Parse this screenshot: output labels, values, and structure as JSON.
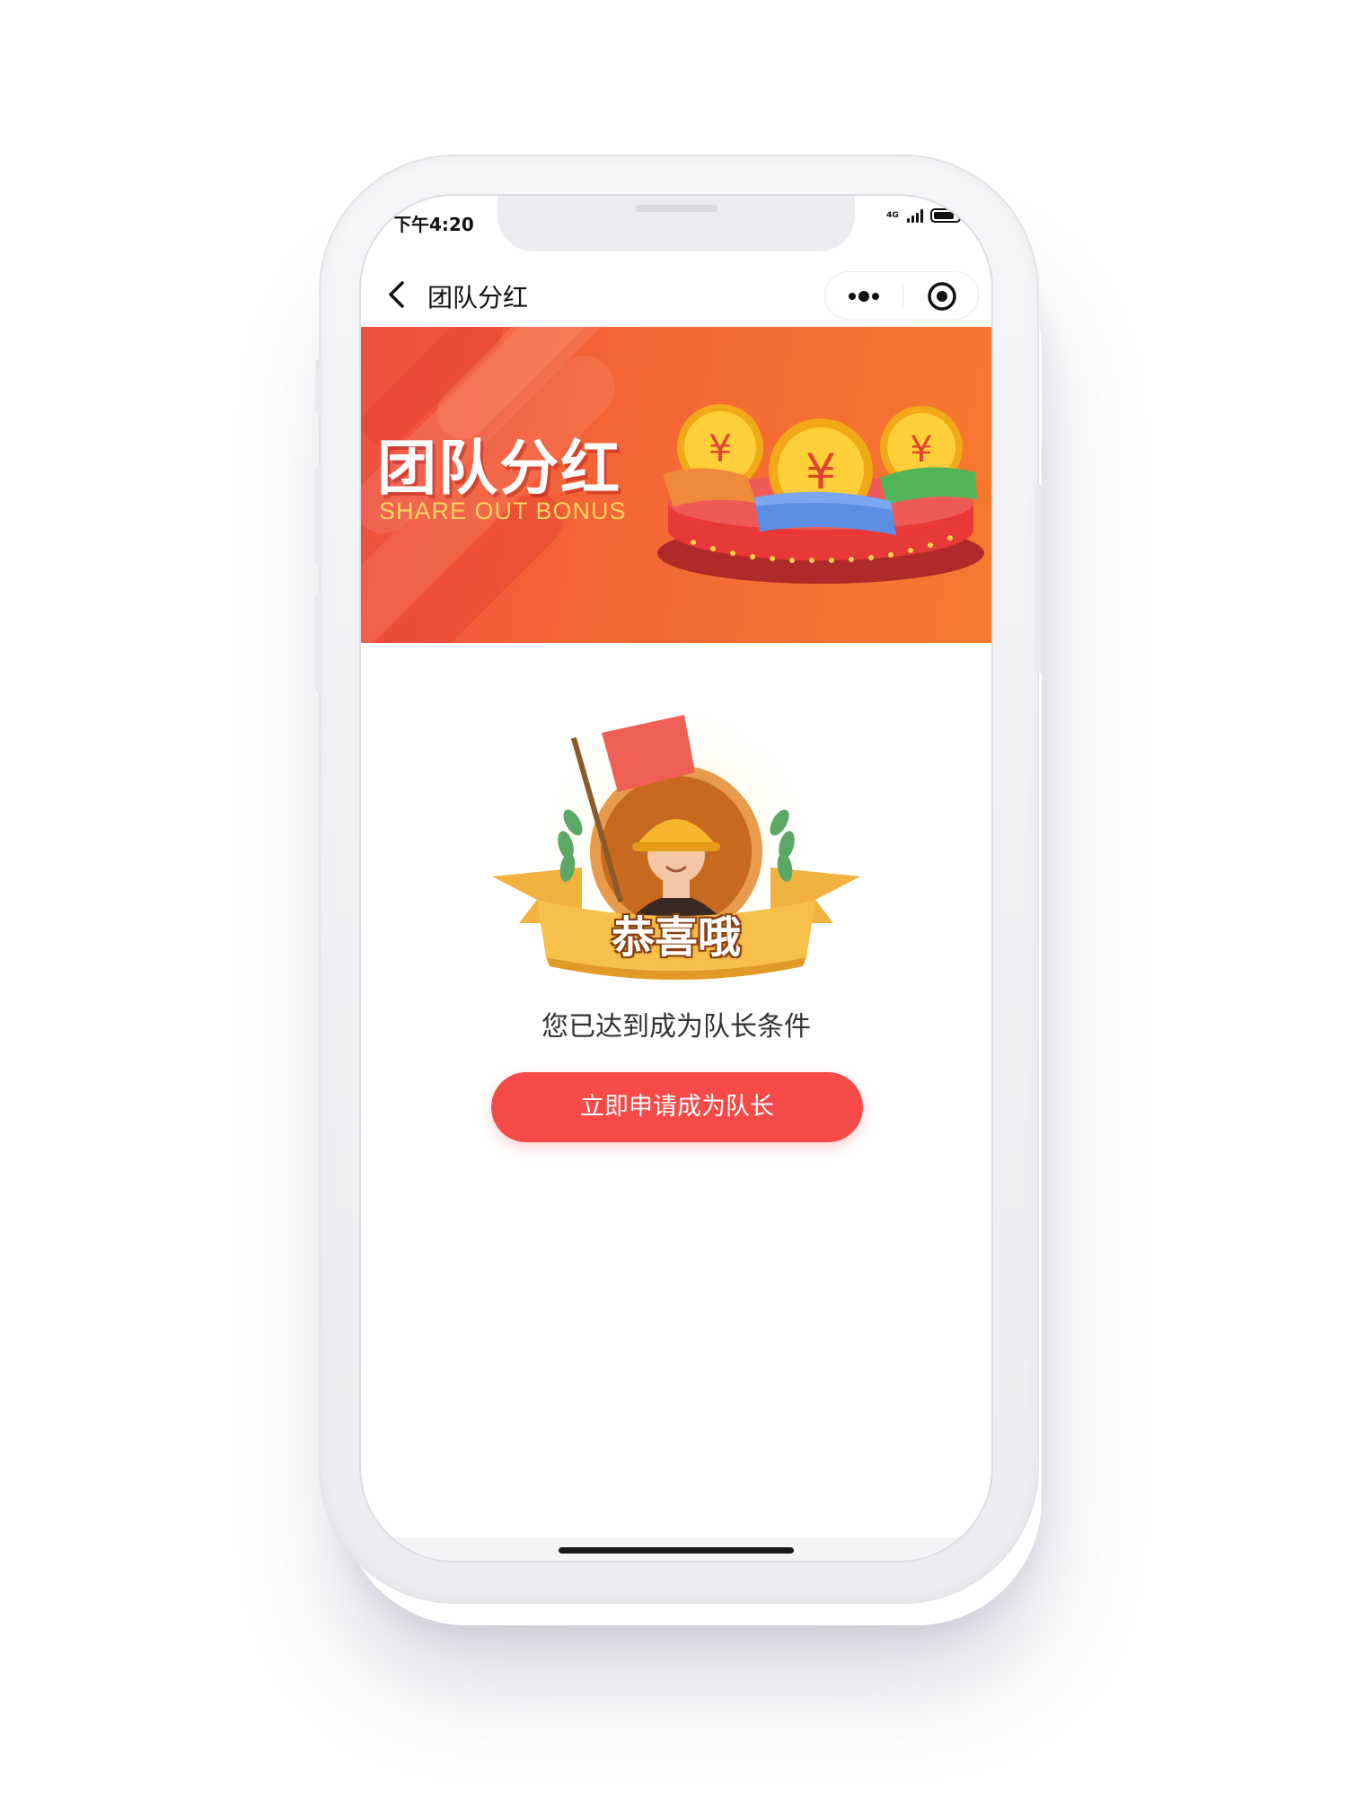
{
  "status_bar": {
    "time": "下午4:20",
    "network": "4G",
    "battery_level": 0.85
  },
  "navbar": {
    "title": "团队分红",
    "back_icon": "chevron-left-icon",
    "menu_icon": "more-dots-icon",
    "close_icon": "target-circle-icon"
  },
  "banner": {
    "title": "团队分红",
    "subtitle": "SHARE OUT BONUS",
    "coin_symbol": "¥"
  },
  "badge": {
    "text": "恭喜哦"
  },
  "content": {
    "message": "您已达到成为队长条件",
    "apply_button": "立即申请成为队长"
  },
  "colors": {
    "primary_button": "#f64a48",
    "banner_start": "#ef4e3c",
    "banner_end": "#f67a2c",
    "banner_subtitle": "#ffd561"
  }
}
